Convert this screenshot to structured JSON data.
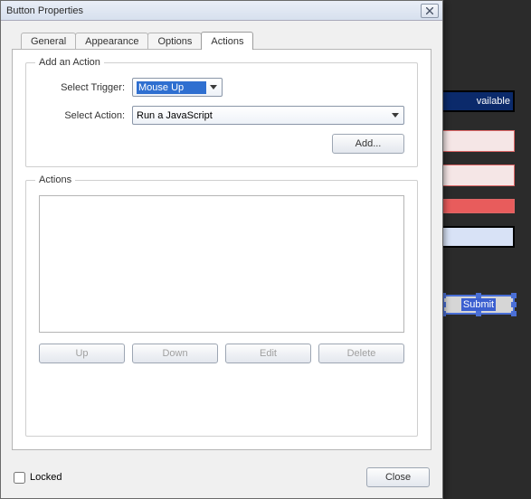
{
  "dialog": {
    "title": "Button Properties",
    "tabs": {
      "general": "General",
      "appearance": "Appearance",
      "options": "Options",
      "actions": "Actions"
    },
    "activeTab": "actions"
  },
  "addAction": {
    "groupTitle": "Add an Action",
    "triggerLabel": "Select Trigger:",
    "triggerValue": "Mouse Up",
    "actionLabel": "Select Action:",
    "actionValue": "Run a JavaScript",
    "addButton": "Add..."
  },
  "actionsGroup": {
    "groupTitle": "Actions",
    "up": "Up",
    "down": "Down",
    "edit": "Edit",
    "del": "Delete"
  },
  "footer": {
    "locked": "Locked",
    "close": "Close"
  },
  "background": {
    "field0": "vailable",
    "submit": "Submit"
  }
}
